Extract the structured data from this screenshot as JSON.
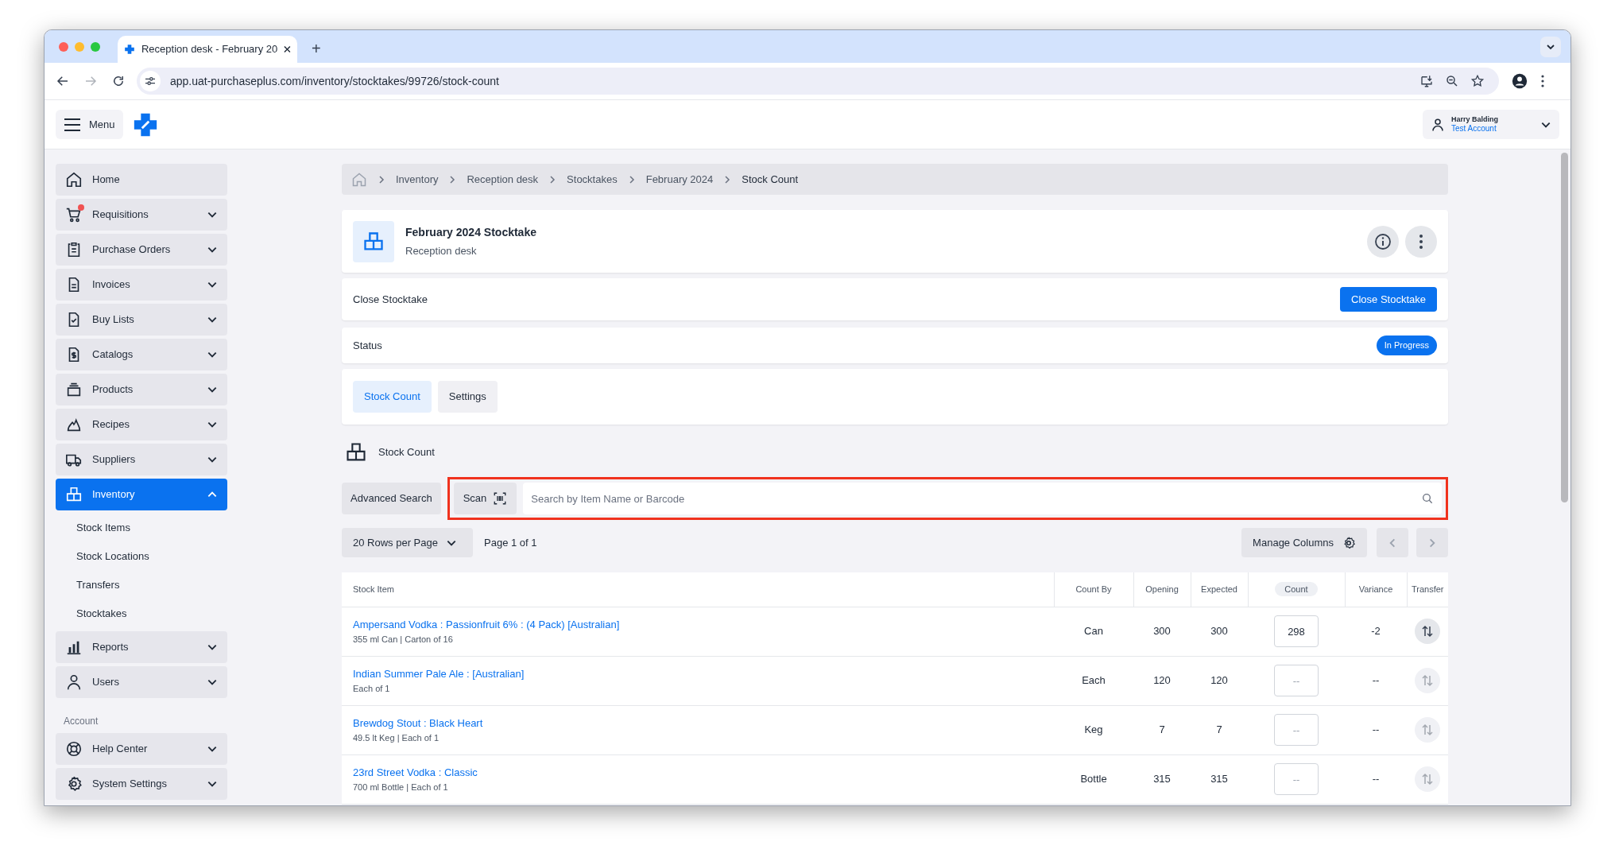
{
  "browser": {
    "tab_title": "Reception desk - February 20",
    "new_tab": "+",
    "url": "app.uat-purchaseplus.com/inventory/stocktakes/99726/stock-count"
  },
  "app_header": {
    "menu_label": "Menu",
    "user": {
      "name": "Harry Balding",
      "account": "Test Account"
    }
  },
  "sidebar": {
    "nav": [
      {
        "label": "Home",
        "kind": "link",
        "selected": false,
        "alert": false
      },
      {
        "label": "Requisitions",
        "kind": "menu",
        "selected": false,
        "expanded": false,
        "alert": true
      },
      {
        "label": "Purchase Orders",
        "kind": "menu",
        "selected": false,
        "expanded": false,
        "alert": false
      },
      {
        "label": "Invoices",
        "kind": "menu",
        "selected": false,
        "expanded": false,
        "alert": false
      },
      {
        "label": "Buy Lists",
        "kind": "menu",
        "selected": false,
        "expanded": false,
        "alert": false
      },
      {
        "label": "Catalogs",
        "kind": "menu",
        "selected": false,
        "expanded": false,
        "alert": false
      },
      {
        "label": "Products",
        "kind": "menu",
        "selected": false,
        "expanded": false,
        "alert": false
      },
      {
        "label": "Recipes",
        "kind": "menu",
        "selected": false,
        "expanded": false,
        "alert": false
      },
      {
        "label": "Suppliers",
        "kind": "menu",
        "selected": false,
        "expanded": false,
        "alert": false
      },
      {
        "label": "Inventory",
        "kind": "menu",
        "selected": true,
        "expanded": true,
        "alert": false,
        "children": [
          {
            "label": "Stock Items"
          },
          {
            "label": "Stock Locations"
          },
          {
            "label": "Transfers"
          },
          {
            "label": "Stocktakes"
          }
        ]
      },
      {
        "label": "Reports",
        "kind": "menu",
        "selected": false,
        "expanded": false,
        "alert": false
      },
      {
        "label": "Users",
        "kind": "menu",
        "selected": false,
        "expanded": false,
        "alert": false
      }
    ],
    "account_heading": "Account",
    "account_items": [
      {
        "label": "Help Center",
        "kind": "menu",
        "selected": false,
        "expanded": false,
        "alert": false
      },
      {
        "label": "System Settings",
        "kind": "menu",
        "selected": false,
        "expanded": false,
        "alert": false
      }
    ]
  },
  "breadcrumb": [
    "Inventory",
    "Reception desk",
    "Stocktakes",
    "February 2024",
    "Stock Count"
  ],
  "header": {
    "title": "February 2024 Stocktake",
    "subtitle": "Reception desk"
  },
  "close_row": {
    "label": "Close Stocktake",
    "button": "Close Stocktake"
  },
  "status_row": {
    "label": "Status",
    "badge": "In Progress"
  },
  "tabs": [
    {
      "label": "Stock Count",
      "selected": true
    },
    {
      "label": "Settings",
      "selected": false
    }
  ],
  "section_title": "Stock Count",
  "search": {
    "advanced_button": "Advanced Search",
    "scan_button": "Scan",
    "placeholder": "Search by Item Name or Barcode",
    "highlighted": true
  },
  "pagination": {
    "rows_per_page": "20 Rows per Page",
    "page_info": "Page 1 of 1",
    "manage_columns": "Manage Columns"
  },
  "table": {
    "columns": [
      {
        "label": "Stock Item",
        "highlighted": false
      },
      {
        "label": "Count By",
        "highlighted": false
      },
      {
        "label": "Opening",
        "highlighted": false
      },
      {
        "label": "Expected",
        "highlighted": false
      },
      {
        "label": "Count",
        "highlighted": true
      },
      {
        "label": "Variance",
        "highlighted": false
      },
      {
        "label": "Transfer",
        "highlighted": false
      }
    ],
    "rows": [
      {
        "item": "Ampersand Vodka : Passionfruit 6% : (4 Pack) [Australian]",
        "detail": "355 ml Can | Carton of 16",
        "count_by": "Can",
        "opening": "300",
        "expected": "300",
        "count": {
          "value": "298"
        },
        "variance": "-2",
        "transfer_enabled": true
      },
      {
        "item": "Indian Summer Pale Ale : [Australian]",
        "detail": "Each of 1",
        "count_by": "Each",
        "opening": "120",
        "expected": "120",
        "count": {
          "placeholder": "--"
        },
        "variance": "--",
        "transfer_enabled": false
      },
      {
        "item": "Brewdog Stout : Black Heart",
        "detail": "49.5 lt Keg | Each of 1",
        "count_by": "Keg",
        "opening": "7",
        "expected": "7",
        "count": {
          "placeholder": "--"
        },
        "variance": "--",
        "transfer_enabled": false
      },
      {
        "item": "23rd Street Vodka : Classic",
        "detail": "700 ml Bottle | Each of 1",
        "count_by": "Bottle",
        "opening": "315",
        "expected": "315",
        "count": {
          "placeholder": "--"
        },
        "variance": "--",
        "transfer_enabled": false
      }
    ]
  }
}
